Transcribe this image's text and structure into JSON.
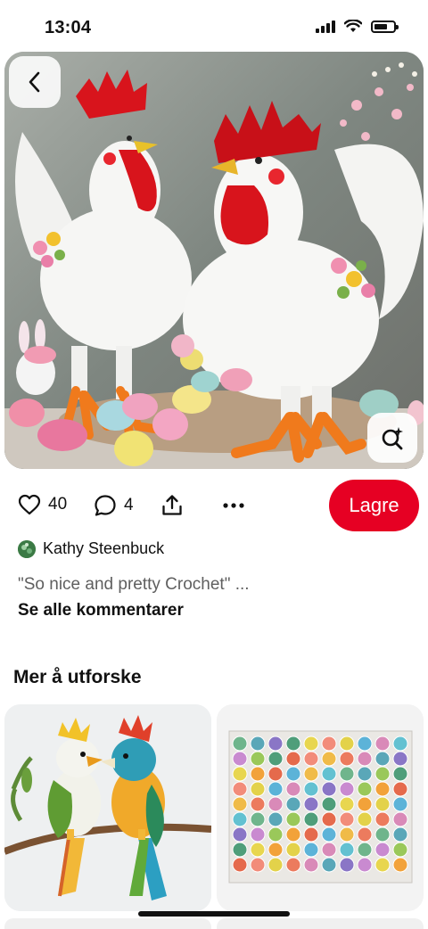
{
  "status_bar": {
    "time": "13:04",
    "battery_level": 0.7
  },
  "pin": {
    "image_icon_back": "chevron-left-icon",
    "image_icon_lens": "visual-search-icon",
    "likes": "40",
    "comments": "4",
    "save_label": "Lagre",
    "author_name": "Kathy Steenbuck",
    "comment_preview": "\"So nice and pretty Crochet\" ...",
    "see_all_comments": "Se alle kommentarer"
  },
  "more_section": {
    "title": "Mer å utforske"
  },
  "colors": {
    "brand_red": "#e60023",
    "text_muted": "#5f5f5f"
  }
}
